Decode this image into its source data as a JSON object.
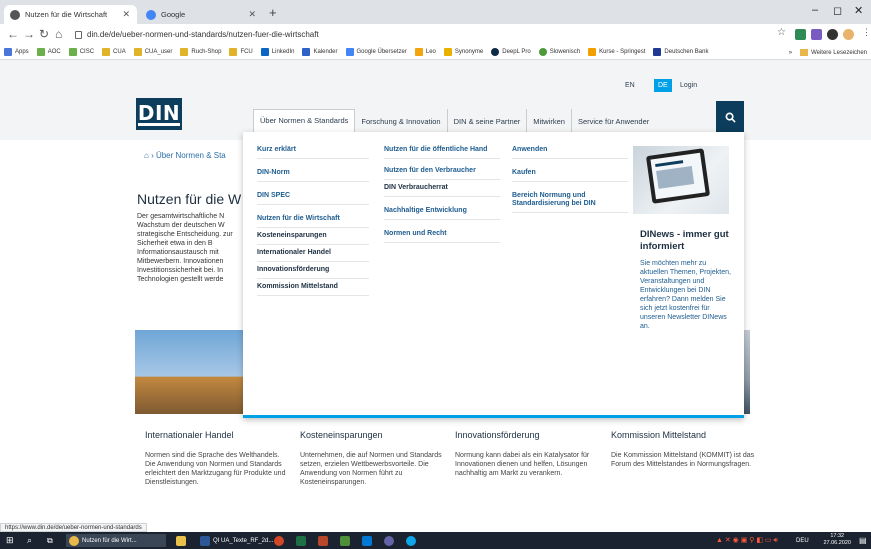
{
  "browser": {
    "tabs": [
      {
        "title": "Nutzen für die Wirtschaft",
        "active": true
      },
      {
        "title": "Google",
        "active": false
      }
    ],
    "url": "din.de/de/ueber-normen-und-standards/nutzen-fuer-die-wirtschaft",
    "bookmarks": [
      "Apps",
      "AOC",
      "CISC",
      "CUA",
      "CUA_user",
      "Ruch-Shop",
      "FCU",
      "LinkedIn",
      "Kalender",
      "Google Übersetzer",
      "Leo",
      "Synonyme",
      "DeepL Pro",
      "Slowenisch",
      "Kurse - Springest",
      "Deutschen Bank"
    ],
    "bookmarks_more": "»",
    "other_bookmarks": "Weitere Lesezeichen",
    "status_url": "https://www.din.de/de/ueber-normen-und-standards"
  },
  "header": {
    "lang_en": "EN",
    "lang_de": "DE",
    "login": "Login",
    "logo": "DIN",
    "nav": [
      "Über Normen & Standards",
      "Forschung & Innovation",
      "DIN & seine Partner",
      "Mitwirken",
      "Service für Anwender"
    ]
  },
  "breadcrumb": "Über Normen & Sta",
  "page": {
    "title": "Nutzen für die W",
    "intro": "Der gesamtwirtschaftliche N Wachstum der deutschen W strategische Entscheidung. zur Sicherheit etwa in den B Informationsaustausch mit Mitbewerbern. Innovationen Investitionssicherheit bei. In Technologien gestellt werde"
  },
  "mega_menu": {
    "col1": [
      "Kurz erklärt",
      "DIN-Norm",
      "DIN SPEC",
      "Nutzen für die Wirtschaft",
      "Kosteneinsparungen",
      "Internationaler Handel",
      "Innovationsförderung",
      "Kommission Mittelstand"
    ],
    "col2": [
      "Nutzen für die öffentliche Hand",
      "Nutzen für den Verbraucher",
      "DIN Verbraucherrat",
      "Nachhaltige Entwicklung",
      "Normen und Recht"
    ],
    "col3": [
      "Anwenden",
      "Kaufen",
      "Bereich Normung und Standardisierung bei DIN"
    ],
    "promo_title": "DINews - immer gut informiert",
    "promo_text": "Sie möchten mehr zu aktuellen Themen, Projekten, Veranstaltungen und Entwicklungen bei DIN erfahren? Dann melden Sie sich jetzt kostenfrei für unseren Newsletter DINews an."
  },
  "cards": [
    {
      "title": "Internationaler Handel",
      "text": "Normen sind die Sprache des Welthandels. Die Anwendung von Normen und Standards erleichtert den Marktzugang für Produkte und Dienstleistungen."
    },
    {
      "title": "Kosteneinsparungen",
      "text": "Unternehmen, die auf Normen und Standards setzen, erzielen Wettbewerbsvorteile. Die Anwendung von Normen führt zu Kosteneinsparungen."
    },
    {
      "title": "Innovationsförderung",
      "text": "Normung kann dabei als ein Katalysator für Innovationen dienen und helfen, Lösungen nachhaltig am Markt zu verankern."
    },
    {
      "title": "Kommission Mittelstand",
      "text": "Die Kommission Mittelstand (KOMMIT) ist das Forum des Mittelstandes in Normungsfragen."
    }
  ],
  "taskbar": {
    "app1": "Nutzen für die Wirt...",
    "app2": "QI UA_Texte_RF_2d...",
    "lang": "DEU",
    "time": "17:32",
    "date": "27.06.2020"
  },
  "colors": {
    "brand": "#0c3d5c",
    "accent": "#00a0e6",
    "link": "#1d5c8f"
  }
}
